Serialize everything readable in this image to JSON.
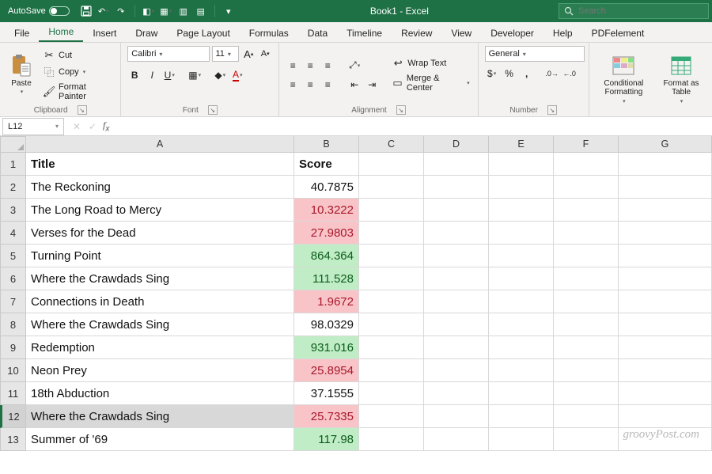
{
  "titlebar": {
    "autosave_label": "AutoSave",
    "title": "Book1  -  Excel",
    "search_placeholder": "Search"
  },
  "tabs": [
    "File",
    "Home",
    "Insert",
    "Draw",
    "Page Layout",
    "Formulas",
    "Data",
    "Timeline",
    "Review",
    "View",
    "Developer",
    "Help",
    "PDFelement"
  ],
  "active_tab": "Home",
  "ribbon": {
    "clipboard": {
      "paste": "Paste",
      "cut": "Cut",
      "copy": "Copy",
      "format_painter": "Format Painter",
      "label": "Clipboard"
    },
    "font": {
      "name": "Calibri",
      "size": "11",
      "label": "Font"
    },
    "alignment": {
      "wrap": "Wrap Text",
      "merge": "Merge & Center",
      "label": "Alignment"
    },
    "number": {
      "format": "General",
      "label": "Number"
    },
    "styles": {
      "cond": "Conditional Formatting",
      "table": "Format as Table"
    }
  },
  "namebox": "L12",
  "columns": [
    "A",
    "B",
    "C",
    "D",
    "E",
    "F",
    "G"
  ],
  "header_row": {
    "title": "Title",
    "score": "Score"
  },
  "rows": [
    {
      "n": 1,
      "title": "Title",
      "score": "Score",
      "bold": true,
      "hi": null
    },
    {
      "n": 2,
      "title": "The Reckoning",
      "score": "40.7875",
      "hi": null
    },
    {
      "n": 3,
      "title": "The Long Road to Mercy",
      "score": "10.3222",
      "hi": "red"
    },
    {
      "n": 4,
      "title": "Verses for the Dead",
      "score": "27.9803",
      "hi": "red"
    },
    {
      "n": 5,
      "title": "Turning Point",
      "score": "864.364",
      "hi": "green"
    },
    {
      "n": 6,
      "title": "Where the Crawdads Sing",
      "score": "111.528",
      "hi": "green"
    },
    {
      "n": 7,
      "title": "Connections in Death",
      "score": "1.9672",
      "hi": "red"
    },
    {
      "n": 8,
      "title": "Where the Crawdads Sing",
      "score": "98.0329",
      "hi": null
    },
    {
      "n": 9,
      "title": "Redemption",
      "score": "931.016",
      "hi": "green"
    },
    {
      "n": 10,
      "title": "Neon Prey",
      "score": "25.8954",
      "hi": "red"
    },
    {
      "n": 11,
      "title": "18th Abduction",
      "score": "37.1555",
      "hi": null
    },
    {
      "n": 12,
      "title": "Where the Crawdads Sing",
      "score": "25.7335",
      "hi": "red",
      "selected": true
    },
    {
      "n": 13,
      "title": "Summer of '69",
      "score": "117.98",
      "hi": "green"
    }
  ],
  "watermark": "groovyPost.com"
}
